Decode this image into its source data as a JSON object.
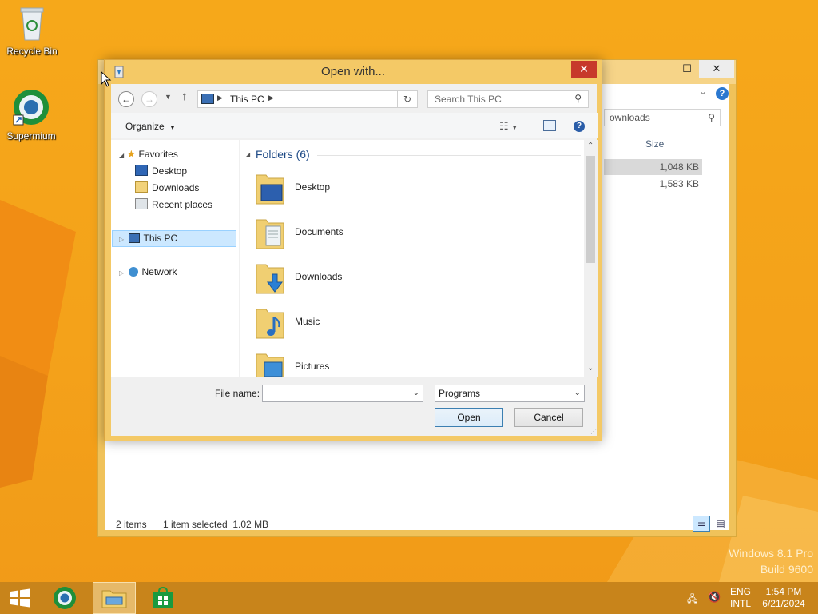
{
  "desktop": {
    "icons": [
      {
        "label": "Recycle Bin",
        "icon": "recycle-bin-icon"
      },
      {
        "label": "Supermium",
        "icon": "supermium-browser-icon"
      }
    ],
    "watermark": {
      "line1": "Windows 8.1 Pro",
      "line2": "Build 9600"
    }
  },
  "background_window": {
    "search_placeholder": "ownloads",
    "column_size": "Size",
    "rows": [
      {
        "size": "1,048 KB",
        "selected": true
      },
      {
        "size": "1,583 KB",
        "selected": false
      }
    ],
    "status": {
      "items": "2 items",
      "selected": "1 item selected  1.02 MB"
    }
  },
  "dialog": {
    "title": "Open with...",
    "close_label": "✕",
    "address": {
      "location": "This PC",
      "search_placeholder": "Search This PC"
    },
    "toolbar": {
      "organize": "Organize"
    },
    "nav": {
      "favorites": "Favorites",
      "favorites_items": [
        "Desktop",
        "Downloads",
        "Recent places"
      ],
      "this_pc": "This PC",
      "network": "Network"
    },
    "content": {
      "group_header": "Folders (6)",
      "folders": [
        {
          "name": "Desktop",
          "icon": "desktop-folder-icon"
        },
        {
          "name": "Documents",
          "icon": "documents-folder-icon"
        },
        {
          "name": "Downloads",
          "icon": "downloads-folder-icon"
        },
        {
          "name": "Music",
          "icon": "music-folder-icon"
        },
        {
          "name": "Pictures",
          "icon": "pictures-folder-icon"
        }
      ]
    },
    "file_name_label": "File name:",
    "file_name_value": "",
    "file_type": "Programs",
    "open_button": "Open",
    "cancel_button": "Cancel"
  },
  "taskbar": {
    "lang_top": "ENG",
    "lang_bottom": "INTL",
    "time": "1:54 PM",
    "date": "6/21/2024"
  },
  "colors": {
    "wallpaper": "#f4a21a",
    "dialog_frame": "#f4c966",
    "close_red": "#c7392b",
    "selection": "#cce8ff"
  }
}
